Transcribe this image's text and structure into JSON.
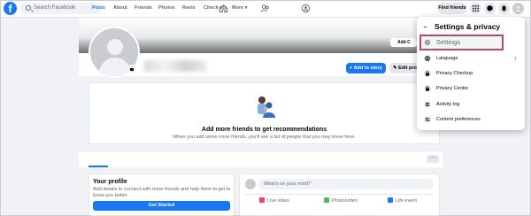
{
  "topbar": {
    "logo_letter": "f",
    "search_placeholder": "Search Facebook",
    "find_friends_label": "Find friends"
  },
  "profile": {
    "add_cover_label": "Add C",
    "add_story_label": "+ Add to story",
    "edit_profile_label": "✎ Edit profil"
  },
  "recommendation": {
    "title": "Add more friends to get recommendations",
    "subtitle": "When you add some more friends, you'll see a list of people that you may know here."
  },
  "tabs": {
    "items": [
      "Posts",
      "About",
      "Friends",
      "Photos",
      "Reels",
      "Check-ins",
      "More ▾"
    ],
    "more_dots": "···"
  },
  "your_profile": {
    "title": "Your profile",
    "description": "Add details to connect with more friends and help them to get to know you better.",
    "button_label": "Get Started"
  },
  "composer": {
    "placeholder": "What's on your mind?",
    "options": [
      "Live video",
      "Photo/video",
      "Life event"
    ]
  },
  "dropdown": {
    "back_arrow": "←",
    "title": "Settings & privacy",
    "items": [
      {
        "label": "Settings",
        "icon": "gear-icon"
      },
      {
        "label": "Language",
        "icon": "globe-icon"
      },
      {
        "label": "Privacy Checkup",
        "icon": "lock-check-icon"
      },
      {
        "label": "Privacy Centre",
        "icon": "lock-icon"
      },
      {
        "label": "Activity log",
        "icon": "list-icon"
      },
      {
        "label": "Content preferences",
        "icon": "sliders-icon"
      }
    ],
    "chevron": "›"
  },
  "colors": {
    "brand_blue": "#1877f2",
    "highlight_border": "#b84a68",
    "live_red": "#f3425f",
    "photo_green": "#45bd62",
    "event_blue": "#1877f2"
  }
}
